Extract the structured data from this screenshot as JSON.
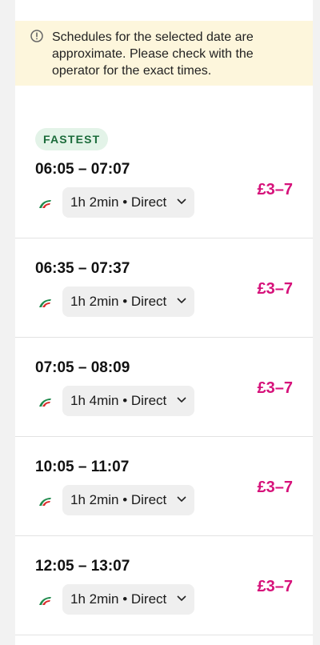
{
  "notice": {
    "icon": "info-circle-icon",
    "text": "Schedules for the selected date are approximate. Please check with the operator for the exact times."
  },
  "colors": {
    "price": "#d6117a",
    "badge_bg": "#e3f3e8",
    "badge_text": "#1b6b3a",
    "notice_bg": "#fdf6dc"
  },
  "journeys": [
    {
      "badge": "FASTEST",
      "times": "06:05 – 07:07",
      "summary": "1h 2min • Direct",
      "price": "£3–7",
      "operator_icon": "trenitalia-logo-icon"
    },
    {
      "times": "06:35 – 07:37",
      "summary": "1h 2min • Direct",
      "price": "£3–7",
      "operator_icon": "trenitalia-logo-icon"
    },
    {
      "times": "07:05 – 08:09",
      "summary": "1h 4min • Direct",
      "price": "£3–7",
      "operator_icon": "trenitalia-logo-icon"
    },
    {
      "times": "10:05 – 11:07",
      "summary": "1h 2min • Direct",
      "price": "£3–7",
      "operator_icon": "trenitalia-logo-icon"
    },
    {
      "times": "12:05 – 13:07",
      "summary": "1h 2min • Direct",
      "price": "£3–7",
      "operator_icon": "trenitalia-logo-icon"
    }
  ]
}
